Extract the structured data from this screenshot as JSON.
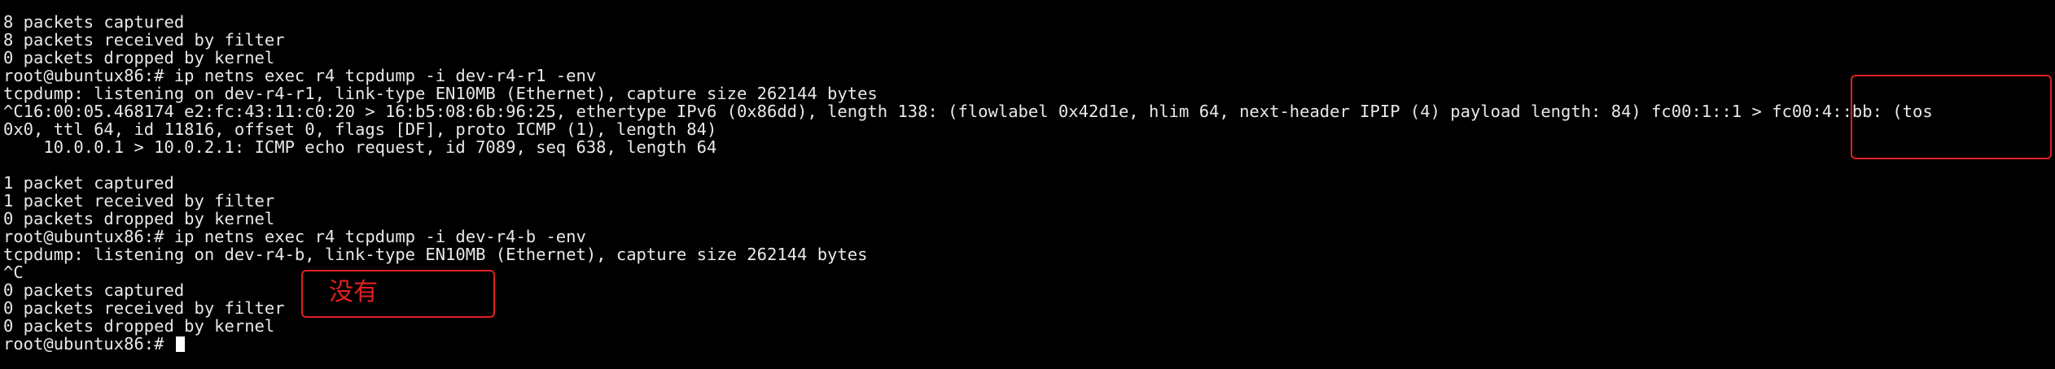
{
  "terminal": {
    "lines": [
      "8 packets captured",
      "8 packets received by filter",
      "0 packets dropped by kernel",
      "root@ubuntux86:# ip netns exec r4 tcpdump -i dev-r4-r1 -env",
      "tcpdump: listening on dev-r4-r1, link-type EN10MB (Ethernet), capture size 262144 bytes",
      "^C16:00:05.468174 e2:fc:43:11:c0:20 > 16:b5:08:6b:96:25, ethertype IPv6 (0x86dd), length 138: (flowlabel 0x42d1e, hlim 64, next-header IPIP (4) payload length: 84) fc00:1::1 > fc00:4::bb: (tos",
      "0x0, ttl 64, id 11816, offset 0, flags [DF], proto ICMP (1), length 84)",
      "    10.0.0.1 > 10.0.2.1: ICMP echo request, id 7089, seq 638, length 64",
      "",
      "1 packet captured",
      "1 packet received by filter",
      "0 packets dropped by kernel",
      "root@ubuntux86:# ip netns exec r4 tcpdump -i dev-r4-b -env",
      "tcpdump: listening on dev-r4-b, link-type EN10MB (Ethernet), capture size 262144 bytes",
      "^C",
      "0 packets captured",
      "0 packets received by filter",
      "0 packets dropped by kernel",
      "root@ubuntux86:# "
    ]
  },
  "annotations": {
    "mid_label": "没有",
    "color": "#e02020"
  }
}
